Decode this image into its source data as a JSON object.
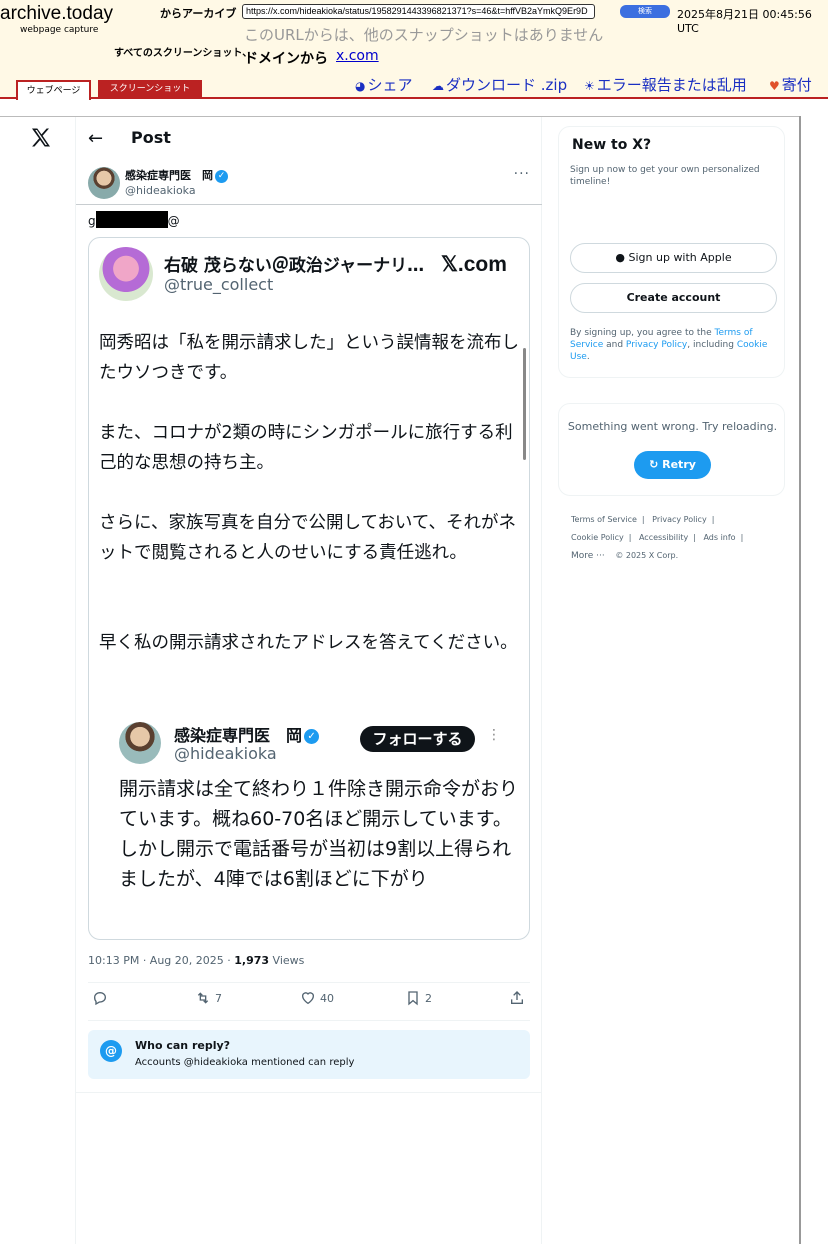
{
  "archive": {
    "logo": "archive.today",
    "sub": "webpage capture",
    "archive_label": "からアーカイブ",
    "url": "https://x.com/hideakioka/status/1958291443396821371?s=46&t=hffVB2aYmkQ9Er9D",
    "search_button": "検索",
    "date": "2025年8月21日 00:45:56 UTC",
    "no_snapshot": "このURLからは、他のスナップショットはありません",
    "all_screenshots_label": "すべてのスクリーンショット、",
    "domain_label": "ドメインから",
    "domain_link": "x.com",
    "share": "シェア",
    "download": "ダウンロード .zip",
    "report": "エラー報告または乱用",
    "donate": "寄付",
    "tab_webpage": "ウェブページ",
    "tab_screenshot": "スクリーンショット"
  },
  "header": {
    "title": "Post"
  },
  "author": {
    "name": "感染症専門医　岡",
    "handle": "@hideakioka"
  },
  "tweet": {
    "text_start": "g",
    "text_end": "@"
  },
  "embed": {
    "name": "右破 茂らない＠政治ジャーナリ…",
    "handle": "@true_collect",
    "brand": "𝕏.com",
    "paragraphs": [
      "岡秀昭は「私を開示請求した」という誤情報を流布したウソつきです。",
      "また、コロナが2類の時にシンガポールに旅行する利己的な思想の持ち主。",
      "さらに、家族写真を自分で公開しておいて、それがネットで閲覧されると人のせいにする責任逃れ。",
      "早く私の開示請求されたアドレスを答えてください。"
    ],
    "inner": {
      "name": "感染症専門医　岡",
      "handle": "@hideakioka",
      "follow": "フォローする",
      "text": "開示請求は全て終わり１件除き開示命令がおりています。概ね60-70名ほど開示しています。しかし開示で電話番号が当初は9割以上得られましたが、4陣では6割ほどに下がり"
    }
  },
  "meta": {
    "time": "10:13 PM · Aug 20, 2025 · ",
    "views_count": "1,973",
    "views_label": " Views"
  },
  "actions": {
    "retweets": "7",
    "likes": "40",
    "bookmarks": "2"
  },
  "reply": {
    "title": "Who can reply?",
    "subtitle": "Accounts @hideakioka mentioned can reply"
  },
  "sidebar": {
    "new_title": "New to X?",
    "new_sub": "Sign up now to get your own personalized timeline!",
    "apple": "Sign up with Apple",
    "create": "Create account",
    "terms_pre": "By signing up, you agree to the ",
    "terms_link": "Terms of Service",
    "terms_and": " and ",
    "privacy_link": "Privacy Policy",
    "terms_incl": ", including ",
    "cookie_link": "Cookie Use",
    "terms_end": ".",
    "error": "Something went wrong. Try reloading.",
    "retry": "Retry"
  },
  "footer": {
    "tos": "Terms of Service",
    "privacy": "Privacy Policy",
    "cookie": "Cookie Policy",
    "access": "Accessibility",
    "ads": "Ads info",
    "more": "More ···",
    "copy": "© 2025 X Corp."
  }
}
